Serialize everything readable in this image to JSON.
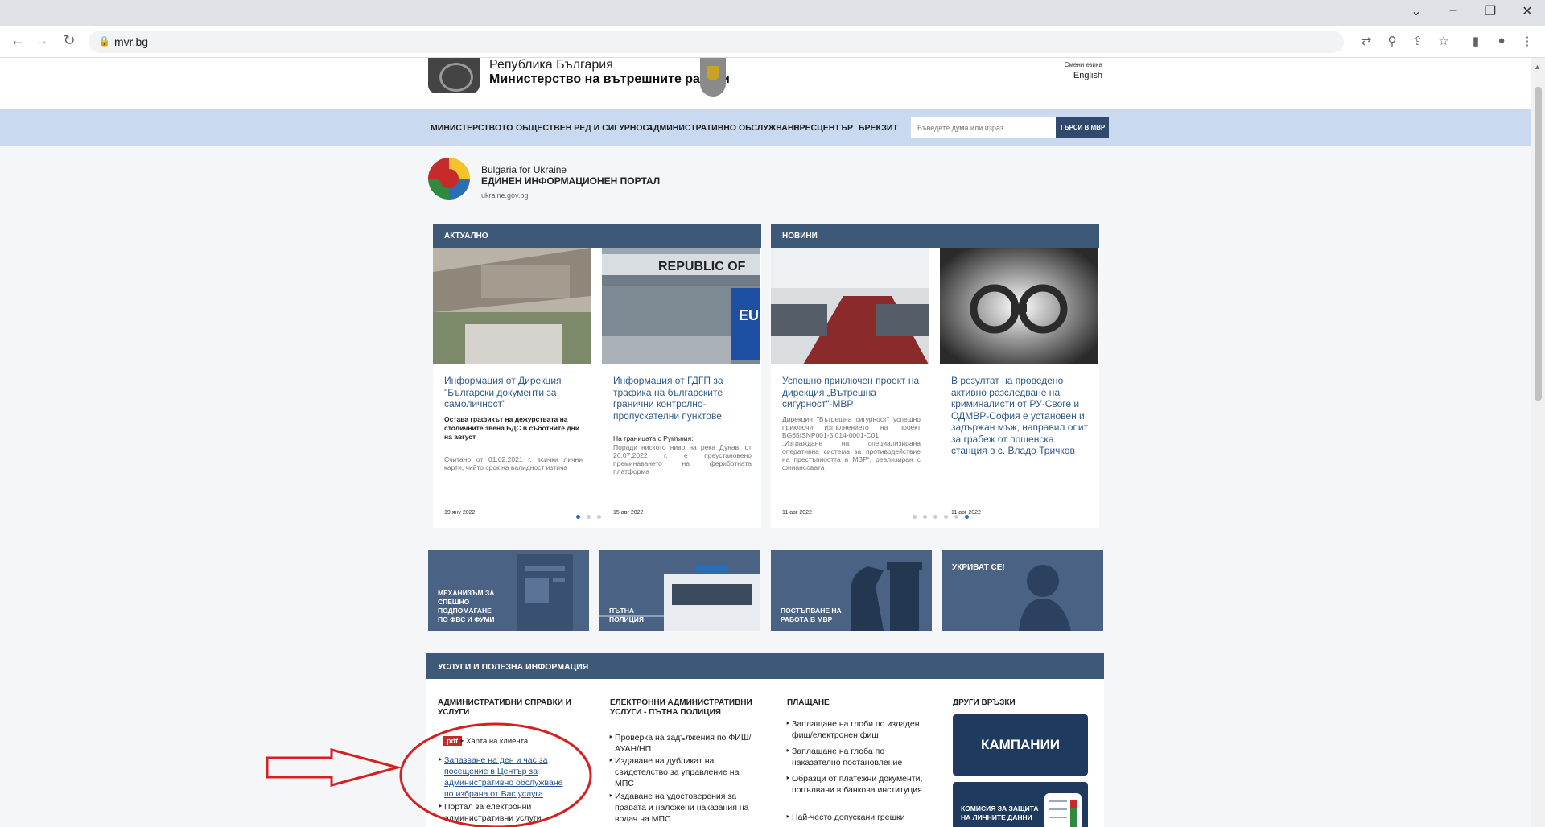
{
  "browser": {
    "url": "mvr.bg"
  },
  "header": {
    "republic": "Република България",
    "ministry": "Министерство на вътрешните работи",
    "lang_label": "Смени езика",
    "lang_link": "English"
  },
  "nav": {
    "items": [
      "МИНИСТЕРСТВОТО",
      "ОБЩЕСТВЕН РЕД И СИГУРНОСТ",
      "АДМИНИСТРАТИВНО ОБСЛУЖВАНЕ",
      "ПРЕСЦЕНТЪР",
      "БРЕКЗИТ"
    ],
    "search_placeholder": "Въведете дума или израз",
    "search_button": "ТЪРСИ В МВР"
  },
  "ukraine": {
    "line1": "Bulgaria for Ukraine",
    "line2": "ЕДИНЕН ИНФОРМАЦИОНЕН ПОРТАЛ",
    "line3": "ukraine.gov.bg"
  },
  "panels": {
    "actual": {
      "heading": "АКТУАЛНО",
      "cards": [
        {
          "title": "Информация от Дирекция \"Български документи за самоличност\"",
          "subtitle": "Остава графикът на дежурствата на столичните звена БДС в съботните дни на август",
          "desc": "Считано от 01.02.2021 г. всички лични карти, чийто срок на валидност изтича",
          "date": "19 яну 2022"
        },
        {
          "title": "Информация от ГДГП за трафика на българските гранични контролно-пропускателни пунктове",
          "subtitle": "На границата с Румъния:",
          "desc": "Поради ниското ниво на река Дунав, от 26.07.2022 г. е преустановено преминаването на фериботната платформа",
          "date": "15 авг 2022"
        }
      ]
    },
    "news": {
      "heading": "НОВИНИ",
      "cards": [
        {
          "title": "Успешно приключен проект на дирекция „Вътрешна сигурност“-МВР",
          "desc": "Дирекция \"Вътрешна сигурност\" успешно приключи изпълнението на проект BG65ISNP001-5.014-0001-C01 „Изграждане на специализирана оперативна система за противодействие на престъпността в МВР“, реализиран с финансовата",
          "date": "11 авг 2022"
        },
        {
          "title": "В резултат на проведено активно разследване на криминалисти от РУ-Своге и ОДМВР-София е установен и задържан мъж, направил опит за грабеж от пощенска станция в с. Владо Тричков",
          "date": "11 авг 2022"
        }
      ]
    }
  },
  "tiles": [
    {
      "label": "МЕХАНИЗЪМ ЗА СПЕШНО ПОДПОМАГАНЕ ПО ФВС И ФУМИ"
    },
    {
      "label": "ПЪТНА ПОЛИЦИЯ"
    },
    {
      "label": "ПОСТЪПВАНЕ НА РАБОТА В МВР"
    },
    {
      "label": "УКРИВАТ СЕ!"
    }
  ],
  "services": {
    "heading": "УСЛУГИ И ПОЛЕЗНА ИНФОРМАЦИЯ",
    "col1": {
      "heading": "АДМИНИСТРАТИВНИ СПРАВКИ И УСЛУГИ",
      "pdf_badge": "pdf",
      "pdf_label": "Харта на клиента",
      "links": [
        "Запазване на ден и час за посещение в Център за административно обслужване по избрана от Вас услуга",
        "Портал за електронни административни услуги"
      ]
    },
    "col2": {
      "heading": "ЕЛЕКТРОННИ АДМИНИСТРАТИВНИ УСЛУГИ - ПЪТНА ПОЛИЦИЯ",
      "links": [
        "Проверка на задължения по ФИШ/АУАН/НП",
        "Издаване на дубликат на свидетелство за управление на МПС",
        "Издаване на удостоверения за правата и наложени наказания на водач на МПС"
      ]
    },
    "col3": {
      "heading": "ПЛАЩАНЕ",
      "links": [
        "Заплащане на глоби по издаден фиш/електронен фиш",
        "Заплащане на глоба по наказателно постановление",
        "Образци от платежни документи, попълвани в банкова институция",
        "Най-често допускани грешки"
      ]
    },
    "col4": {
      "heading": "ДРУГИ ВРЪЗКИ",
      "campaigns": "КАМПАНИИ",
      "privacy": "КОМИСИЯ ЗА ЗАЩИТА НА ЛИЧНИТЕ ДАННИ"
    }
  },
  "colors": {
    "nav_bg": "#c9daf0",
    "panel_head": "#3e5878",
    "accent_link": "#2f5a88",
    "annotation_red": "#d42020"
  }
}
